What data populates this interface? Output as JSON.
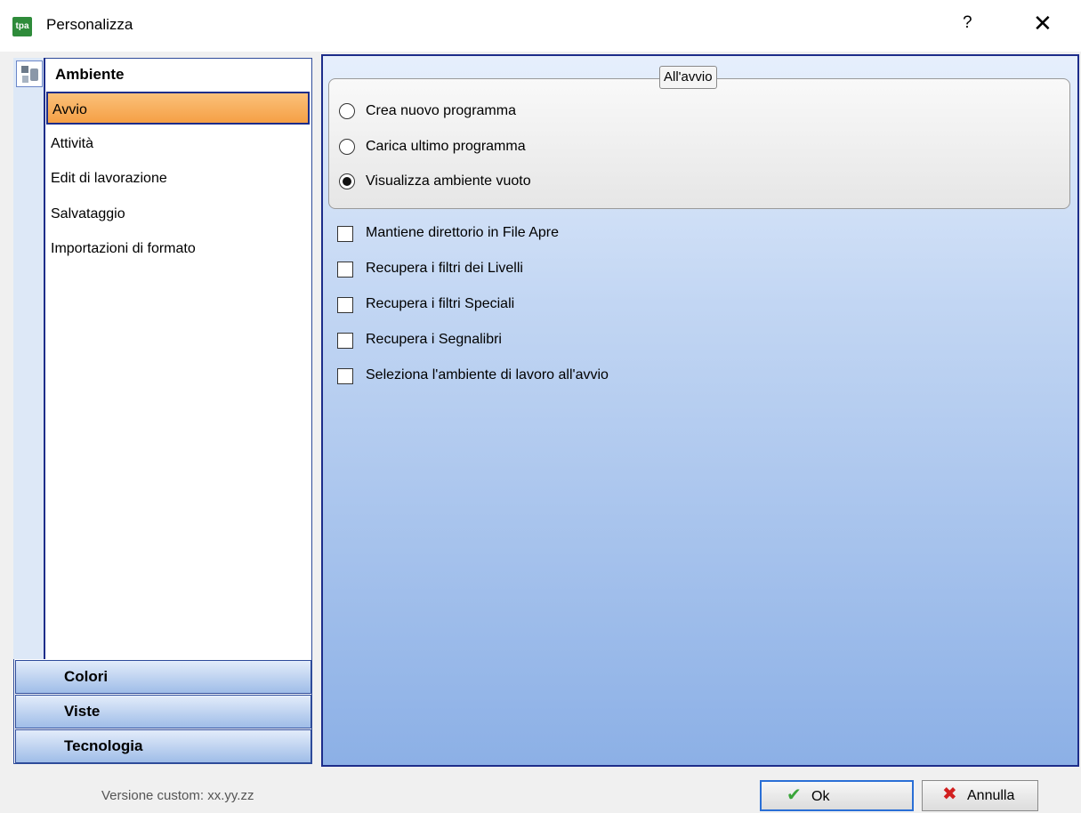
{
  "window": {
    "title": "Personalizza",
    "help_label": "?",
    "close_label": "✕",
    "icon_text": "tpa"
  },
  "nav": {
    "group_header": "Ambiente",
    "items": [
      {
        "label": "Avvio",
        "selected": true
      },
      {
        "label": "Attività",
        "selected": false
      },
      {
        "label": "Edit di lavorazione",
        "selected": false
      },
      {
        "label": "Salvataggio",
        "selected": false
      },
      {
        "label": "Importazioni di formato",
        "selected": false
      }
    ],
    "bottom_groups": [
      "Colori",
      "Viste",
      "Tecnologia"
    ]
  },
  "startup": {
    "legend": "All'avvio",
    "options": [
      {
        "label": "Crea nuovo programma",
        "checked": false
      },
      {
        "label": "Carica ultimo programma",
        "checked": false
      },
      {
        "label": "Visualizza ambiente vuoto",
        "checked": true
      }
    ]
  },
  "checkboxes": [
    {
      "label": "Mantiene direttorio in File Apre",
      "checked": false
    },
    {
      "label": "Recupera i filtri dei Livelli",
      "checked": false
    },
    {
      "label": "Recupera i filtri Speciali",
      "checked": false
    },
    {
      "label": "Recupera i Segnalibri",
      "checked": false
    },
    {
      "label": "Seleziona l'ambiente di lavoro all'avvio",
      "checked": false
    }
  ],
  "footer": {
    "version": "Versione custom: xx.yy.zz",
    "ok_label": "Ok",
    "cancel_label": "Annulla"
  },
  "colors": {
    "selected_item": "#f5a045",
    "panel_border": "#1d2d8a",
    "ok_icon": "#3aa53a",
    "cancel_icon": "#d22020"
  }
}
